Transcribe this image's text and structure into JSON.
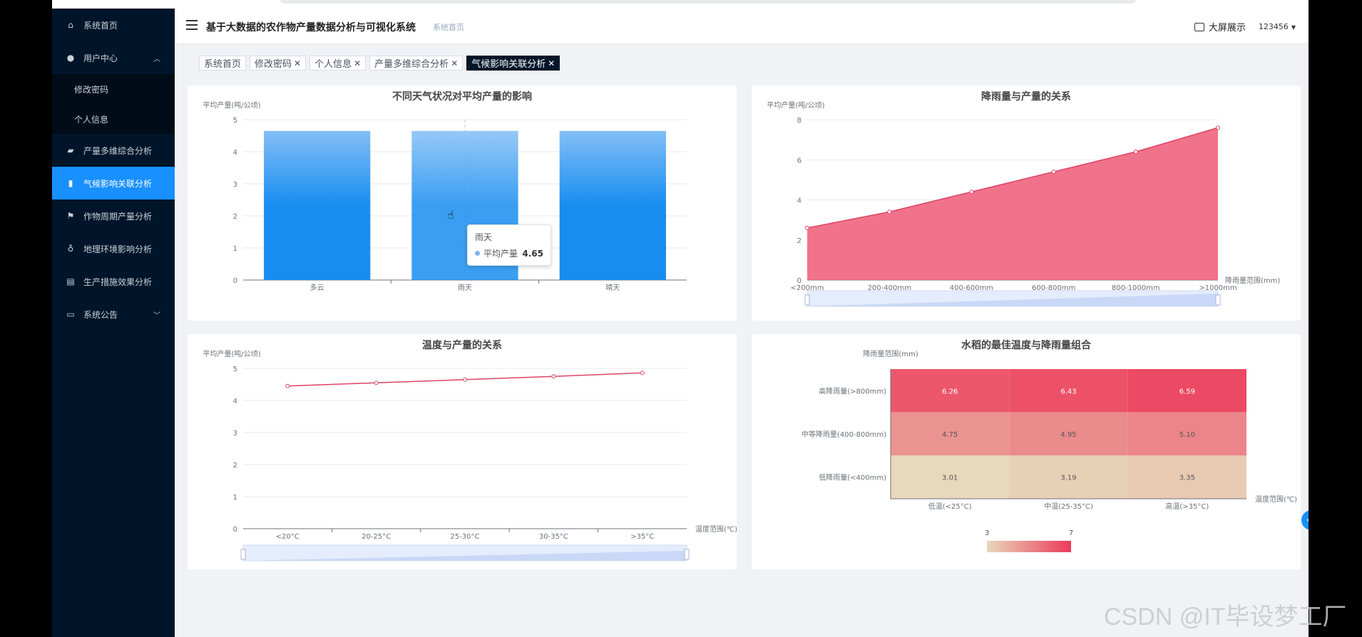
{
  "header": {
    "app_title": "基于大数据的农作物产量数据分析与可视化系统",
    "breadcrumb": "系统首页",
    "screen_button": "大屏展示",
    "username": "123456"
  },
  "sidebar": {
    "items": [
      {
        "label": "系统首页",
        "icon": "home-icon"
      },
      {
        "label": "用户中心",
        "icon": "user-icon"
      },
      {
        "label": "修改密码"
      },
      {
        "label": "个人信息"
      },
      {
        "label": "产量多维综合分析",
        "icon": "briefcase-icon"
      },
      {
        "label": "气候影响关联分析",
        "icon": "bar-chart-icon"
      },
      {
        "label": "作物周期产量分析",
        "icon": "flag-icon"
      },
      {
        "label": "地理环境影响分析",
        "icon": "microphone-icon"
      },
      {
        "label": "生产措施效果分析",
        "icon": "clipboard-icon"
      },
      {
        "label": "系统公告",
        "icon": "monitor-icon"
      }
    ]
  },
  "tags": [
    "系统首页",
    "修改密码",
    "个人信息",
    "产量多维综合分析",
    "气候影响关联分析"
  ],
  "tooltip": {
    "title": "雨天",
    "series": "平均产量",
    "value": "4.65"
  },
  "watermark": "CSDN @IT毕设梦工厂",
  "colors": {
    "sidebar": "#001529",
    "active": "#1890ff",
    "bar": "#1890ff",
    "area": "#ee5a77",
    "line": "#dd4466"
  },
  "chart_data": [
    {
      "type": "bar",
      "title": "不同天气状况对平均产量的影响",
      "ylabel": "平均产量(吨/公顷)",
      "categories": [
        "多云",
        "雨天",
        "晴天"
      ],
      "values": [
        4.65,
        4.65,
        4.65
      ],
      "ylim": [
        0,
        5
      ],
      "yticks": [
        "0",
        "1",
        "2",
        "3",
        "4",
        "5"
      ]
    },
    {
      "type": "area",
      "title": "降雨量与产量的关系",
      "ylabel": "平均产量(吨/公顷)",
      "xlabel": "降雨量范围(mm)",
      "categories": [
        "<200mm",
        "200-400mm",
        "400-600mm",
        "600-800mm",
        "800-1000mm",
        ">1000mm"
      ],
      "values": [
        2.6,
        3.4,
        4.4,
        5.4,
        6.4,
        7.6
      ],
      "ylim": [
        0,
        8
      ],
      "yticks": [
        "0",
        "2",
        "4",
        "6",
        "8"
      ]
    },
    {
      "type": "line",
      "title": "温度与产量的关系",
      "ylabel": "平均产量(吨/公顷)",
      "xlabel": "温度范围(℃)",
      "categories": [
        "<20°C",
        "20-25°C",
        "25-30°C",
        "30-35°C",
        ">35°C"
      ],
      "values": [
        4.45,
        4.55,
        4.65,
        4.75,
        4.86
      ],
      "ylim": [
        0,
        5
      ],
      "yticks": [
        "0",
        "1",
        "2",
        "3",
        "4",
        "5"
      ]
    },
    {
      "type": "heatmap",
      "title": "水稻的最佳温度与降雨量组合",
      "ylabel": "降雨量范围(mm)",
      "xlabel": "温度范围(℃)",
      "x": [
        "低温(<25°C)",
        "中温(25-35°C)",
        "高温(>35°C)"
      ],
      "y": [
        "高降雨量(>800mm)",
        "中等降雨量(400-800mm)",
        "低降雨量(<400mm)"
      ],
      "values": [
        [
          6.26,
          6.43,
          6.59
        ],
        [
          4.75,
          4.95,
          5.1
        ],
        [
          3.01,
          3.19,
          3.35
        ]
      ],
      "display": [
        [
          "6.26",
          "6.43",
          "6.59"
        ],
        [
          "4.75",
          "4.95",
          "5.10"
        ],
        [
          "3.01",
          "3.19",
          "3.35"
        ]
      ],
      "visual_map": [
        "3",
        "7"
      ]
    }
  ]
}
